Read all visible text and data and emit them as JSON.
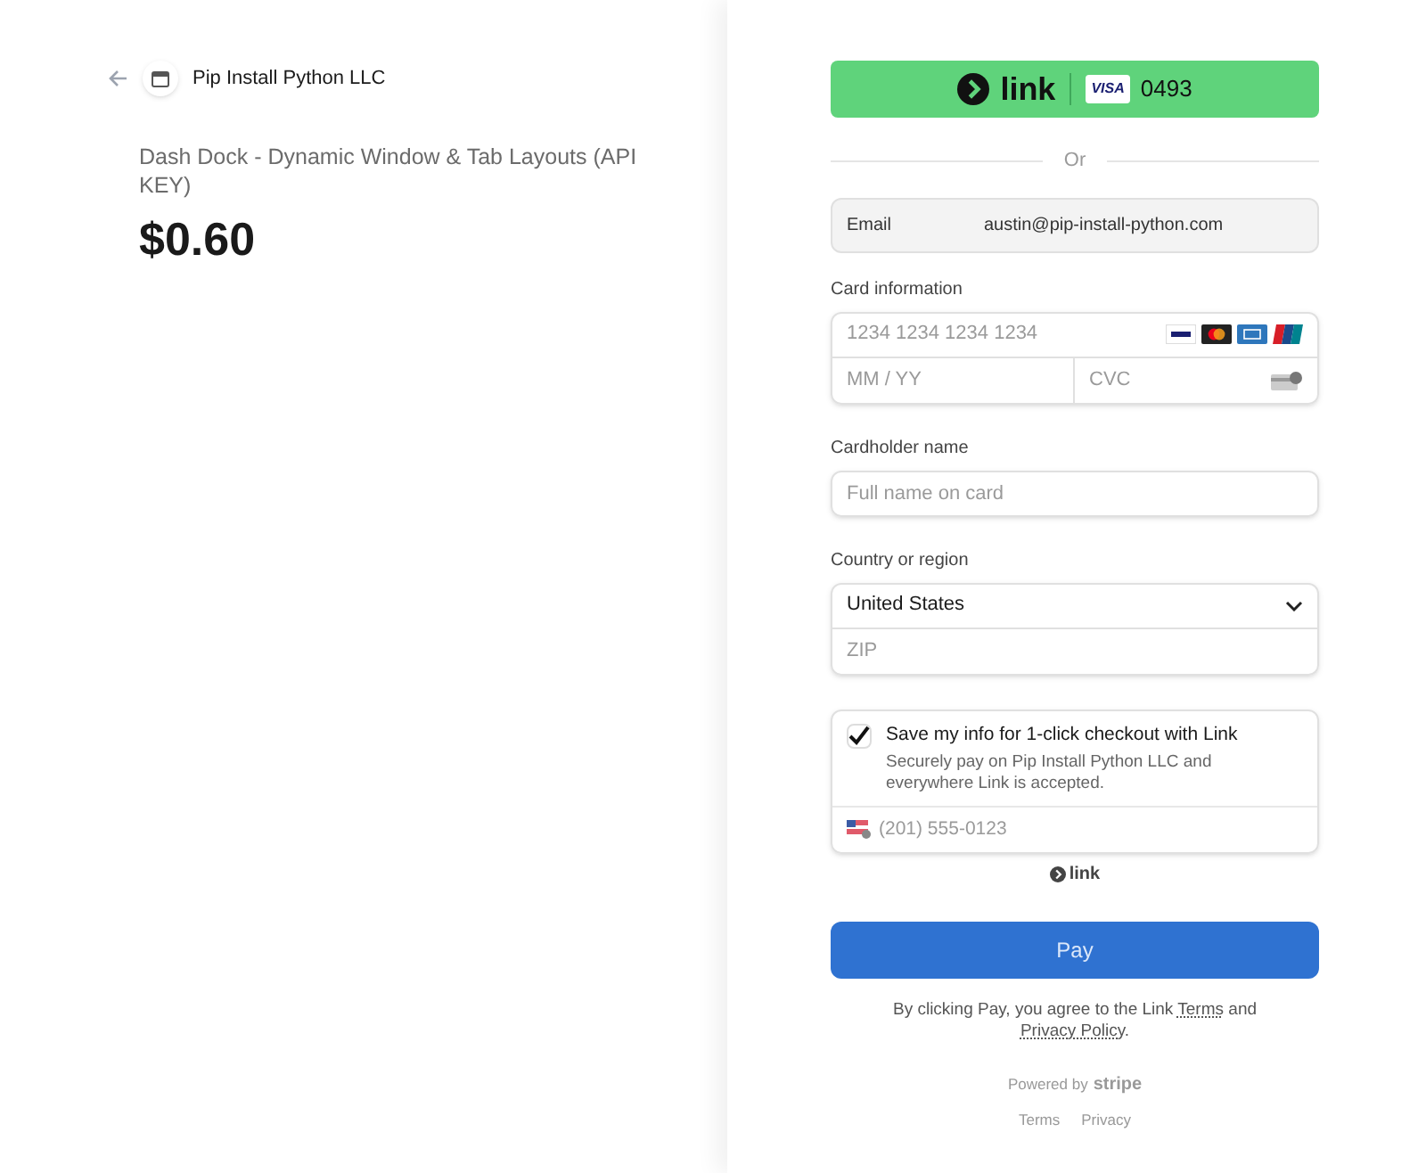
{
  "merchant": {
    "name": "Pip Install Python LLC"
  },
  "product": {
    "name": "Dash Dock - Dynamic Window & Tab Layouts (API KEY)",
    "price": "$0.60"
  },
  "link_button": {
    "brand": "link",
    "card_brand": "VISA",
    "last4": "0493"
  },
  "divider_text": "Or",
  "email": {
    "label": "Email",
    "value": "austin@pip-install-python.com"
  },
  "card": {
    "label": "Card information",
    "number_placeholder": "1234 1234 1234 1234",
    "expiry_placeholder": "MM / YY",
    "cvc_placeholder": "CVC"
  },
  "cardholder": {
    "label": "Cardholder name",
    "placeholder": "Full name on card"
  },
  "country": {
    "label": "Country or region",
    "value": "United States",
    "zip_placeholder": "ZIP"
  },
  "save_info": {
    "checked": true,
    "title": "Save my info for 1-click checkout with Link",
    "description": "Securely pay on Pip Install Python LLC and everywhere Link is accepted.",
    "phone_placeholder": "(201) 555-0123",
    "brand": "link"
  },
  "pay_button": "Pay",
  "agreement": [
    {
      "kind": "text",
      "text": "By clicking Pay, you agree to the Link "
    },
    {
      "kind": "link",
      "text": "Terms"
    },
    {
      "kind": "text",
      "text": " and "
    },
    {
      "kind": "link",
      "text": "Privacy Policy"
    },
    {
      "kind": "text",
      "text": "."
    }
  ],
  "powered_by": {
    "text": "Powered by",
    "brand": "stripe"
  },
  "footer_links": [
    "Terms",
    "Privacy"
  ]
}
